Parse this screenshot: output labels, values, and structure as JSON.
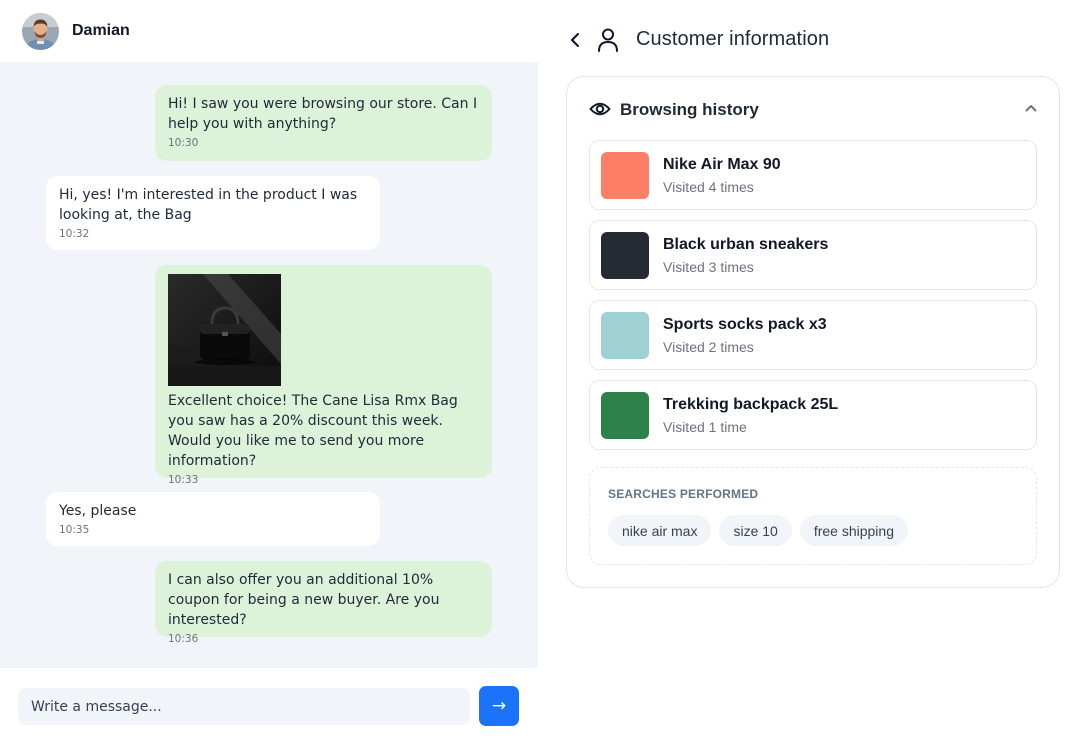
{
  "chat": {
    "contact_name": "Damian",
    "messages": [
      {
        "direction": "out",
        "text": "Hi! I saw you were browsing our store. Can I help you with anything?",
        "time": "10:30"
      },
      {
        "direction": "in",
        "text": "Hi, yes! I'm interested in the product I was looking at, the Bag",
        "time": "10:32"
      },
      {
        "direction": "out",
        "has_image": true,
        "text": "Excellent choice! The Cane Lisa Rmx Bag you saw has a 20% discount this week. Would you like me to send you more information?",
        "time": "10:33"
      },
      {
        "direction": "in",
        "text": "Yes, please",
        "time": "10:35"
      },
      {
        "direction": "out",
        "text": "I can also offer you an additional 10% coupon for being a new buyer. Are you interested?",
        "time": "10:36"
      }
    ],
    "composer": {
      "placeholder": "Write a message...",
      "send_label": "→"
    }
  },
  "customer": {
    "title": "Customer information",
    "browsing": {
      "title": "Browsing history",
      "items": [
        {
          "name": "Nike Air Max 90",
          "visits": "Visited 4 times",
          "color": "#fd7f68"
        },
        {
          "name": "Black urban sneakers",
          "visits": "Visited 3 times",
          "color": "#262a33"
        },
        {
          "name": "Sports socks pack x3",
          "visits": "Visited 2 times",
          "color": "#9fd0d4"
        },
        {
          "name": "Trekking backpack 25L",
          "visits": "Visited 1 time",
          "color": "#2e8249"
        }
      ]
    },
    "searches": {
      "label": "SEARCHES PERFORMED",
      "terms": [
        "nike air max",
        "size 10",
        "free shipping"
      ]
    }
  },
  "colors": {
    "accent": "#1a73f8",
    "outgoing_bubble": "#dcf3d9",
    "incoming_bubble": "#ffffff",
    "chat_background": "#f1f5f9"
  },
  "icons": {
    "back": "chevron-left-icon",
    "person": "user-icon",
    "eye": "eye-icon",
    "collapse": "chevron-up-icon",
    "send": "arrow-right-icon"
  }
}
